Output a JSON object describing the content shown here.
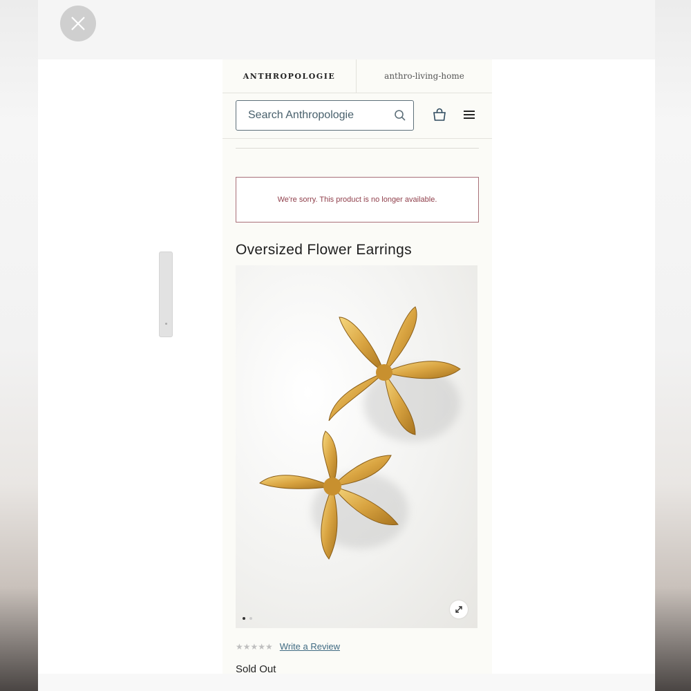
{
  "brand": {
    "left_logo": "ANTHROPOLOGIE",
    "right_logo": "anthro-living-home"
  },
  "search": {
    "placeholder": "Search Anthropologie"
  },
  "icons": {
    "close": "close-icon",
    "search": "search-icon",
    "bag": "shopping-bag-icon",
    "menu": "hamburger-menu-icon",
    "expand": "expand-icon",
    "rating": "star-icon"
  },
  "alert": {
    "message": "We're sorry. This product is no longer available."
  },
  "product": {
    "title": "Oversized Flower Earrings",
    "rating": "★★★★★",
    "rating_value": 0,
    "rating_max": 5,
    "review_link": "Write a Review",
    "status": "Sold Out",
    "carousel_count": 2,
    "carousel_active": 1
  },
  "colors": {
    "alert_border": "#a86f78",
    "alert_text": "#8f3e4a",
    "link": "#3f6a82",
    "gold": "#d9a441"
  }
}
